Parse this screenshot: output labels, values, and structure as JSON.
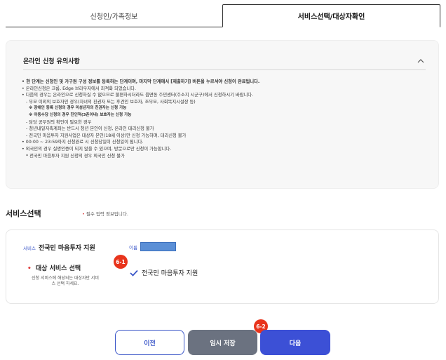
{
  "tabs": [
    {
      "label": "신청인/가족정보",
      "active": false
    },
    {
      "label": "서비스선택/대상자확인",
      "active": true
    }
  ],
  "notice": {
    "title": "온라인 신청 유의사항",
    "chevron_icon": "chevron-up-icon",
    "lines": [
      "현 단계는 신청인 및 가구원 구성 정보를 등록하는 단계이며, 마지막 단계에서 [제출하기] 버튼을 누르셔야 신청이 완료됩니다.",
      "온라인신청은 크롬, Edge 브라우저에서 최적화 되었습니다.",
      "다음의 경우는 온라인으로 신청하실 수 없으므로 불편하시더라도 읍면동 주민센터(주소지 시군구)에서 신청하시기 바랍니다.",
      "- 부모 이외의 보호자인 경우(자녀의 친권자 또는 후견인 보호자, 조부모, 사회복지시설장 등)",
      "※ 장애인 등록 신청의 경우 미성년자의 친권자는 신청 가능",
      "※ 아동수당 신청의 경우 친인척(3촌이내) 보호자는 신청 가능",
      "- 담당 공무원의 확인이 필요한 경우",
      "- 청년내일저축계좌는 반드시 청년 본인이 신청, 온라인 대리신청 불가",
      "- 전국민 마음투자 지원사업은 대상자 본인(18세 이상)만 신청 가능하며, 대리신청 불가",
      "00:00 ~ 23:59까지 신청완료 시 신청당일이 신청일이 됩니다.",
      "외국인의 경우 실명인증이 되지 않을 수 있으며, 방문으로만 신청이 가능합니다.",
      "* 전국민 마음투자 지원 신청의 경우 외국인 신청 불가"
    ]
  },
  "service_section": {
    "title": "서비스선택",
    "required_dot": "•",
    "required_note": "필수 입력 정보입니다."
  },
  "service_box": {
    "tag": "서비스",
    "name": "전국민 마음투자 지원",
    "name_label": "이름",
    "target_title": "대상 서비스 선택",
    "target_desc": "신청 서비스에 해당되는 대상자만 서비스 선택 하세요.",
    "option_label": "전국민 마음투자 지원",
    "option_checked": true
  },
  "badges": {
    "step1": "6-1",
    "step2": "6-2"
  },
  "buttons": {
    "prev": "이전",
    "save": "임시 저장",
    "next": "다음"
  },
  "colors": {
    "accent": "#3c50d6",
    "badge": "#e8341c",
    "save_button": "#6b7280"
  }
}
